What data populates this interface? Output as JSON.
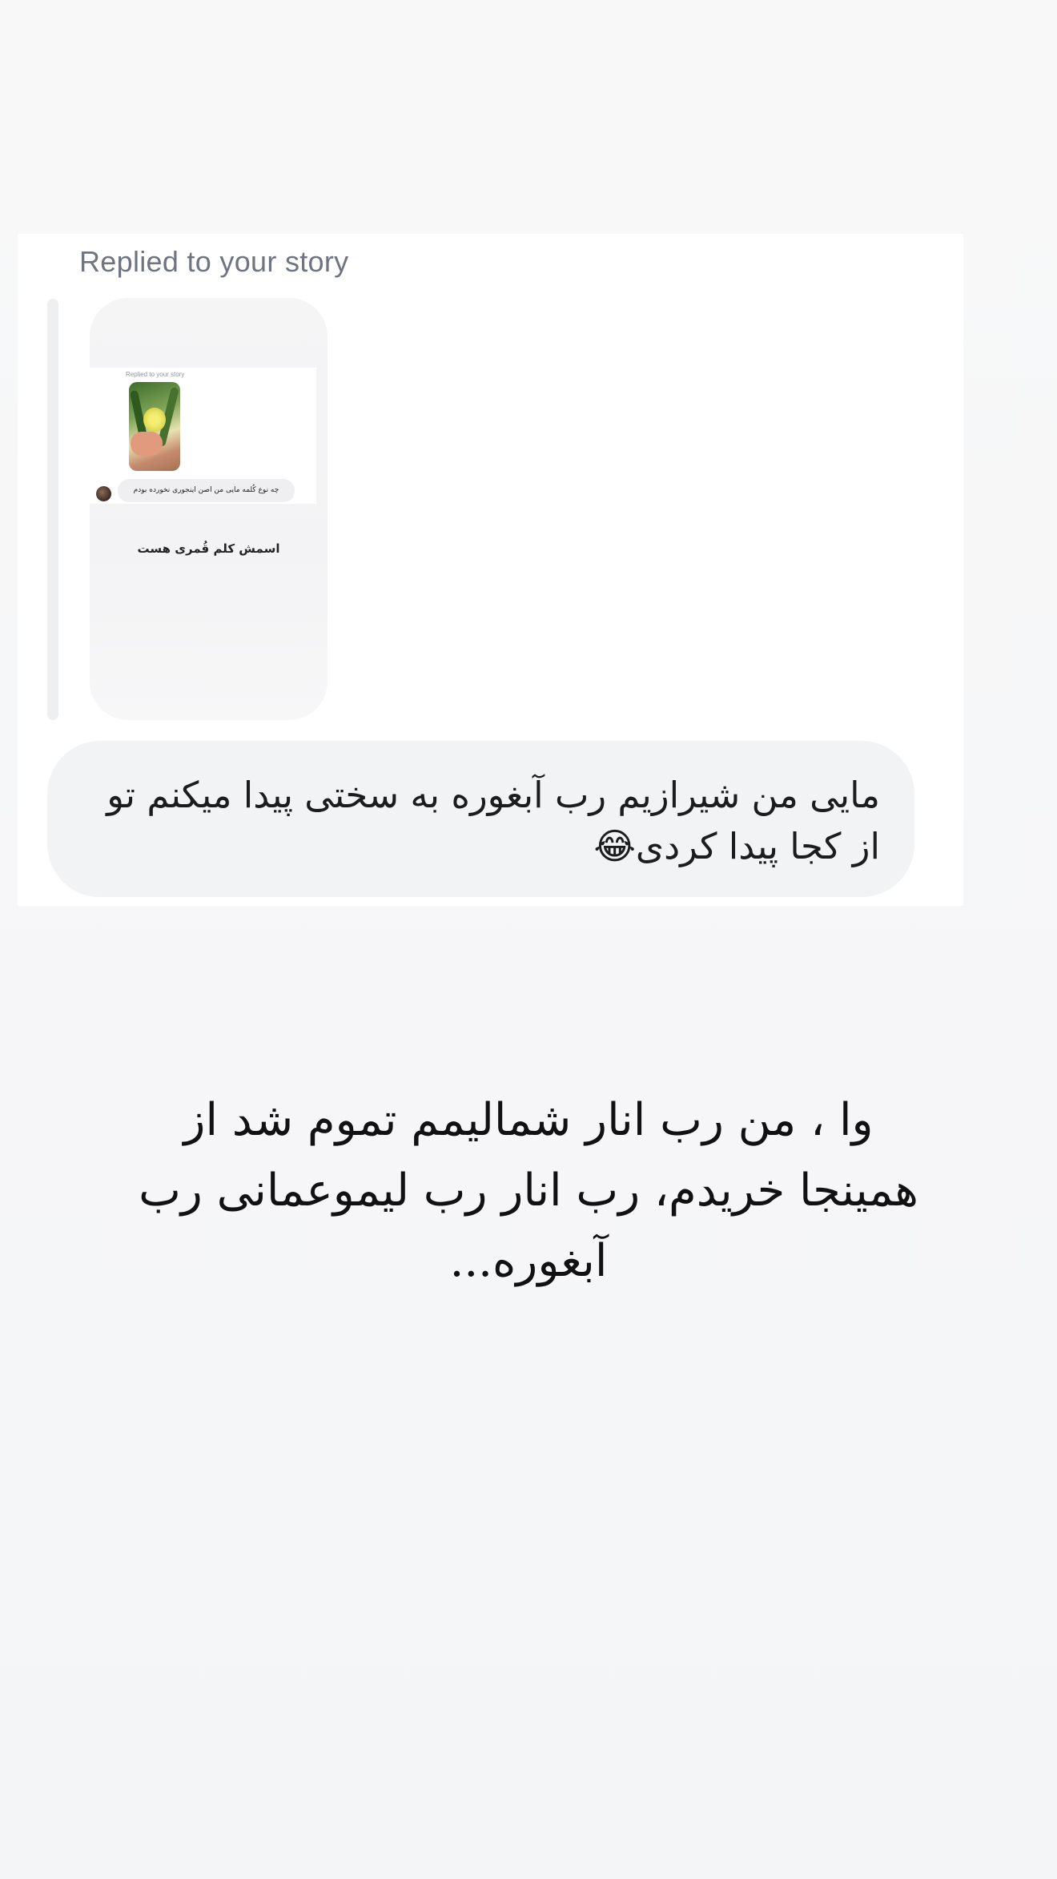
{
  "story_reply": {
    "header": "Replied to your story",
    "thumbnail": {
      "label": "Replied to your story",
      "quoted_message": "چه نوع کُلمه مایی من اصن اینجوری نخورده بودم",
      "caption": "اسمش کلم قُمری هست"
    },
    "message": "مایی من شیرازیم رب آبغوره به سختی پیدا میکنم تو از کجا پیدا کردی😂"
  },
  "story_caption": "وا ، من رب انار شمالیمم تموم شد از همینجا خریدم، رب انار رب لیموعمانی رب آبغوره..."
}
